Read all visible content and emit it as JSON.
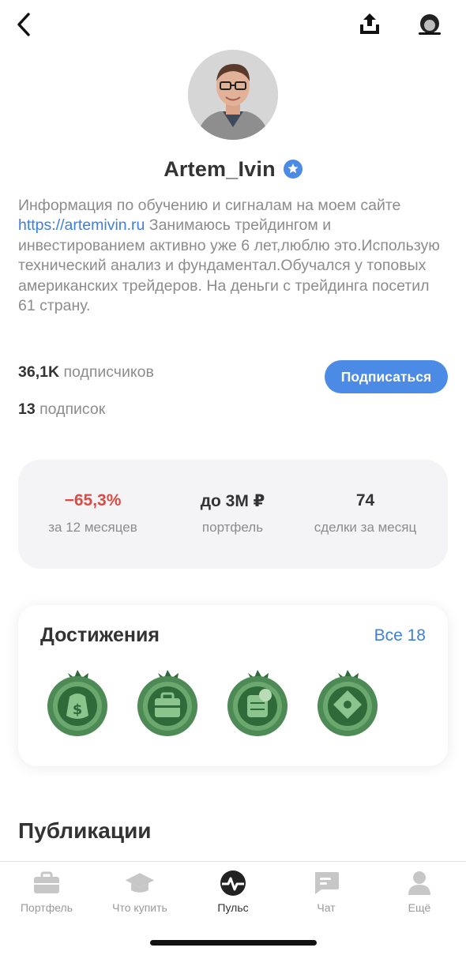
{
  "profile": {
    "name": "Artem_Ivin",
    "bio_before": "Информация по обучению и сигналам на моем сайте ",
    "bio_link": "https://artemivin.ru",
    "bio_after": " Занимаюсь трейдингом и инвестированием активно уже 6 лет,люблю это.Использую технический анализ и фундаментал.Обучался у топовых американских трейдеров. На деньги с трейдинга посетил 61 страну.",
    "followers_count": "36,1K",
    "followers_label": "подписчиков",
    "following_count": "13",
    "following_label": "подписок",
    "subscribe_label": "Подписаться"
  },
  "stats": [
    {
      "value": "−65,3%",
      "label": "за 12 месяцев",
      "negative": true
    },
    {
      "value": "до 3М ₽",
      "label": "портфель",
      "negative": false
    },
    {
      "value": "74",
      "label": "сделки за месяц",
      "negative": false
    }
  ],
  "achievements": {
    "title": "Достижения",
    "all_label": "Все 18",
    "badges": [
      "money-bag-badge-icon",
      "briefcase-badge-icon",
      "coins-badge-icon",
      "rocket-badge-icon"
    ]
  },
  "publications": {
    "title": "Публикации"
  },
  "tabbar": {
    "items": [
      {
        "label": "Портфель",
        "icon": "briefcase-icon",
        "active": false
      },
      {
        "label": "Что купить",
        "icon": "graduation-cap-icon",
        "active": false
      },
      {
        "label": "Пульс",
        "icon": "pulse-icon",
        "active": true
      },
      {
        "label": "Чат",
        "icon": "chat-icon",
        "active": false
      },
      {
        "label": "Ещё",
        "icon": "person-icon",
        "active": false
      }
    ]
  },
  "colors": {
    "accent": "#4b8be6",
    "link": "#3d7fe0",
    "negative": "#dc4a45",
    "badge_green": "#4e8a55"
  }
}
